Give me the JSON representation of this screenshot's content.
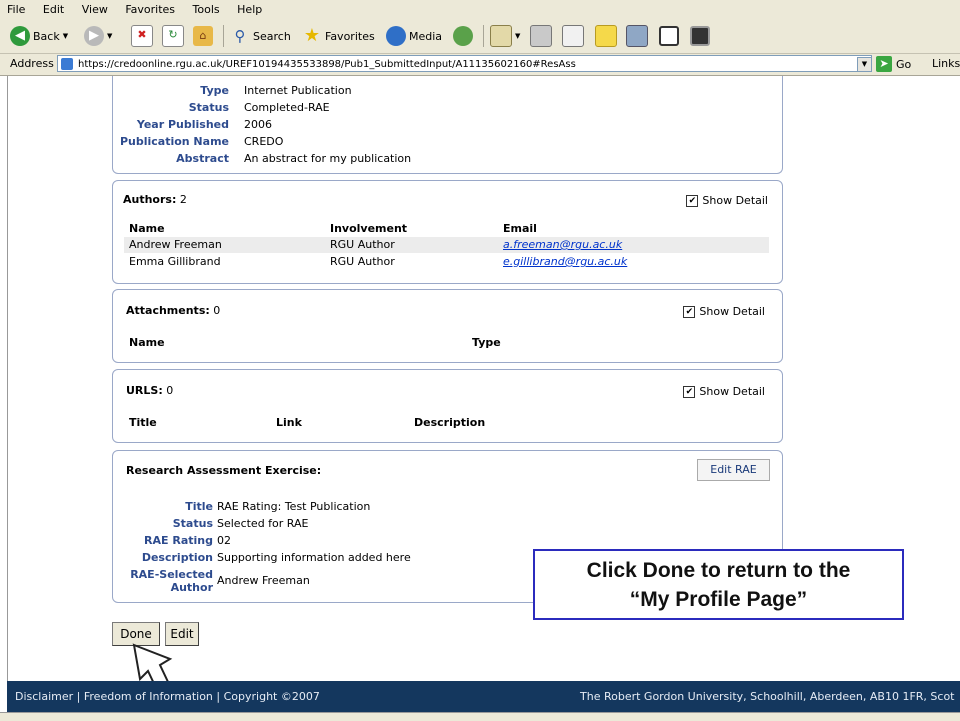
{
  "menu": [
    "File",
    "Edit",
    "View",
    "Favorites",
    "Tools",
    "Help"
  ],
  "toolbar": {
    "back_label": "Back",
    "search_label": "Search",
    "favorites_label": "Favorites",
    "media_label": "Media"
  },
  "address": {
    "label": "Address",
    "url": "https://credoonline.rgu.ac.uk/UREF10194435533898/Pub1_SubmittedInput/A11135602160#ResAss",
    "go_label": "Go",
    "links_label": "Links"
  },
  "publication": {
    "fields": [
      {
        "key": "Type",
        "value": "Internet Publication"
      },
      {
        "key": "Status",
        "value": "Completed-RAE"
      },
      {
        "key": "Year Published",
        "value": "2006"
      },
      {
        "key": "Publication Name",
        "value": "CREDO"
      },
      {
        "key": "Abstract",
        "value": "An abstract for my publication"
      }
    ]
  },
  "authors": {
    "title": "Authors:",
    "count": "2",
    "show_detail": "Show Detail",
    "columns": [
      "Name",
      "Involvement",
      "Email"
    ],
    "rows": [
      [
        "Andrew Freeman",
        "RGU Author",
        "a.freeman@rgu.ac.uk"
      ],
      [
        "Emma Gillibrand",
        "RGU Author",
        "e.gillibrand@rgu.ac.uk"
      ]
    ]
  },
  "attachments": {
    "title": "Attachments:",
    "count": "0",
    "show_detail": "Show Detail",
    "columns": [
      "Name",
      "Type"
    ]
  },
  "urls": {
    "title": "URLS:",
    "count": "0",
    "show_detail": "Show Detail",
    "columns": [
      "Title",
      "Link",
      "Description"
    ]
  },
  "rae": {
    "title": "Research Assessment Exercise:",
    "edit_label": "Edit RAE",
    "fields": [
      {
        "key": "Title",
        "value": "RAE Rating: Test Publication"
      },
      {
        "key": "Status",
        "value": "Selected for RAE"
      },
      {
        "key": "RAE Rating",
        "value": "02"
      },
      {
        "key": "Description",
        "value": "Supporting information added here"
      },
      {
        "key_line1": "RAE-Selected",
        "key_line2": "Author",
        "value": "Andrew Freeman"
      }
    ]
  },
  "buttons": {
    "done": "Done",
    "edit": "Edit"
  },
  "callout": {
    "line1": "Click Done to return to the",
    "line2": "“My Profile Page”"
  },
  "footer": {
    "left": "Disclaimer | Freedom of Information | Copyright ©2007",
    "right": "The Robert Gordon University, Schoolhill, Aberdeen, AB10 1FR, Scot"
  },
  "colors": {
    "footer_bg": "#14375e",
    "label_blue": "#2d4b8e",
    "callout_border": "#2b2bbd"
  }
}
